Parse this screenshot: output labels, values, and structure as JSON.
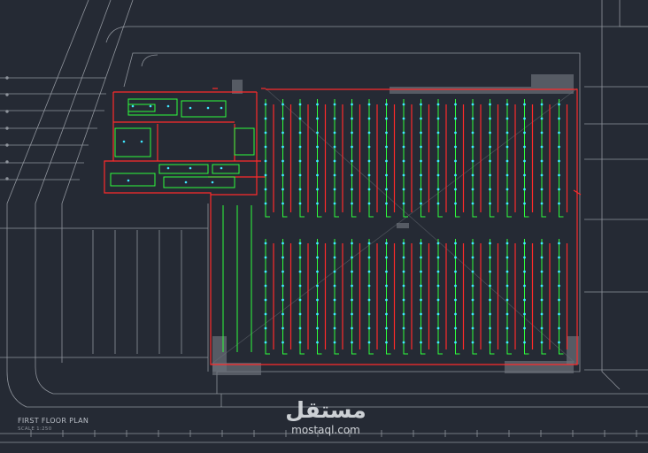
{
  "drawing": {
    "title": "FIRST FLOOR PLAN",
    "scale": "SCALE 1:250"
  },
  "watermark": {
    "arabic": "مستقل",
    "latin": "mostaql.com"
  },
  "colors": {
    "background": "#252a34",
    "linework": "#8f949c",
    "wall": "#ff2a2a",
    "circuit": "#2dff3c",
    "fixture": "#3fe8ff",
    "hatch": "#6b7079"
  },
  "layers": [
    "site-outline",
    "building-walls",
    "lighting-circuits",
    "fixtures",
    "annotations"
  ]
}
